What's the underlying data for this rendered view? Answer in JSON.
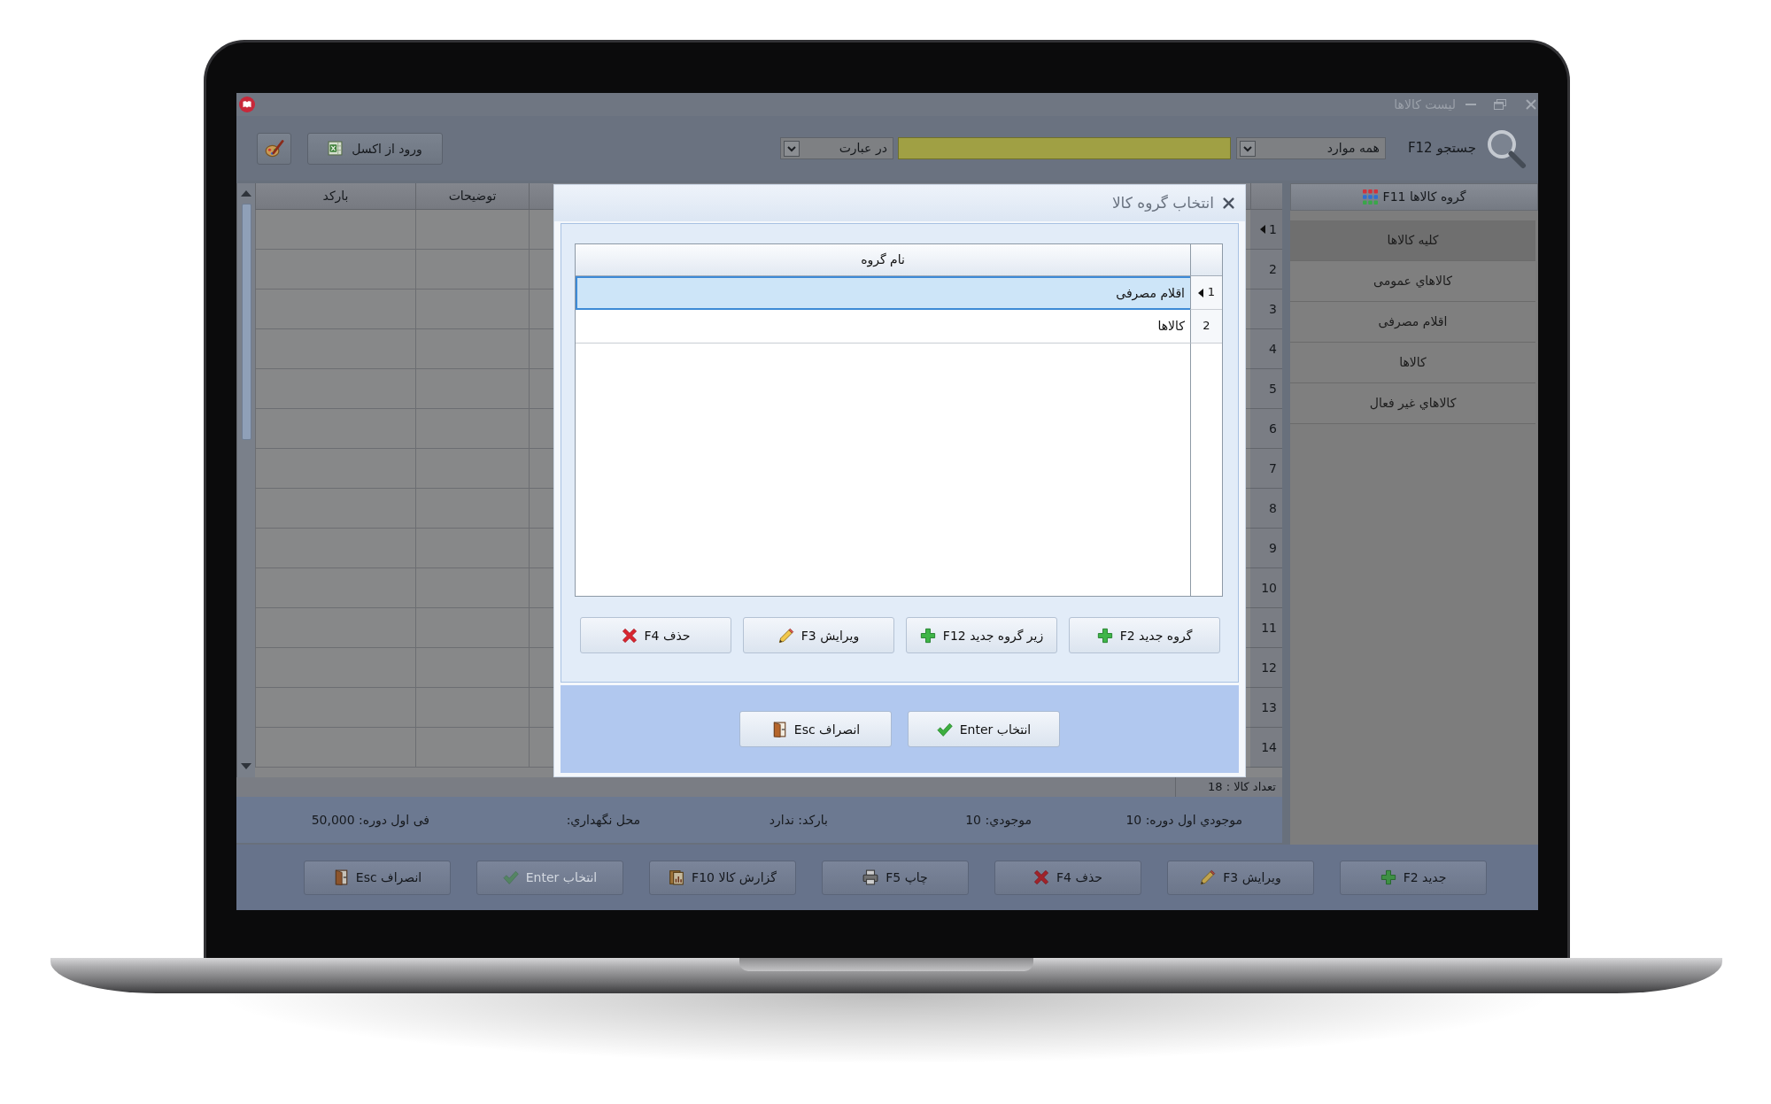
{
  "window": {
    "title": "لیست کالاها"
  },
  "toolbar": {
    "search_label": "جستجو F12",
    "scope": "همه موارد",
    "match_mode": "در عبارت",
    "import_button": "ورود از اکسل"
  },
  "sidebar": {
    "title": "گروه کالاها F11",
    "items": [
      {
        "label": "کلیه کالاها",
        "selected": true
      },
      {
        "label": "کالاهاي عمومی",
        "selected": false
      },
      {
        "label": "اقلام مصرفی",
        "selected": false
      },
      {
        "label": "کالاها",
        "selected": false
      },
      {
        "label": "کالاهاي غیر فعال",
        "selected": false
      }
    ]
  },
  "grid": {
    "columns": [
      "توضیحات",
      "بارکد"
    ],
    "rows": [
      {
        "number": "1",
        "selected": true
      },
      {
        "number": "2",
        "selected": false
      },
      {
        "number": "3",
        "selected": false
      },
      {
        "number": "4",
        "selected": false
      },
      {
        "number": "5",
        "selected": false
      },
      {
        "number": "6",
        "selected": false
      },
      {
        "number": "7",
        "selected": false
      },
      {
        "number": "8",
        "selected": false
      },
      {
        "number": "9",
        "selected": false
      },
      {
        "number": "10",
        "selected": false
      },
      {
        "number": "11",
        "selected": false
      },
      {
        "number": "12",
        "selected": false
      },
      {
        "number": "13",
        "selected": false
      },
      {
        "number": "14",
        "selected": false
      }
    ],
    "count": "تعداد کالا : 18"
  },
  "details": [
    "موجودي اول دوره: 10",
    "موجودي: 10",
    "بارکد: ندارد",
    "محل نگهداري:",
    "فی اول دوره: 50,000"
  ],
  "buttons": [
    {
      "label": "جدید F2",
      "kind": "add",
      "disabled": false
    },
    {
      "label": "ویرایش F3",
      "kind": "edit",
      "disabled": false
    },
    {
      "label": "حذف F4",
      "kind": "delete",
      "disabled": false
    },
    {
      "label": "چاپ F5",
      "kind": "print",
      "disabled": false
    },
    {
      "label": "گزارش کالا F10",
      "kind": "report",
      "disabled": false
    },
    {
      "label": "انتخاب Enter",
      "kind": "confirm",
      "disabled": true
    },
    {
      "label": "انصراف Esc",
      "kind": "cancel",
      "disabled": false
    }
  ],
  "dialog": {
    "title": "انتخاب گروه کالا",
    "columns": [
      "نام گروه"
    ],
    "rows": [
      {
        "number": "1",
        "name": "اقلام مصرفی",
        "selected": true
      },
      {
        "number": "2",
        "name": "کالاها",
        "selected": false
      }
    ],
    "actions": [
      {
        "label": "گروه جدید F2",
        "kind": "add"
      },
      {
        "label": "زیر گروه جدید F12",
        "kind": "add"
      },
      {
        "label": "ویرایش F3",
        "kind": "edit"
      },
      {
        "label": "حذف F4",
        "kind": "delete"
      }
    ],
    "footer_buttons": [
      {
        "label": "انتخاب Enter",
        "kind": "confirm"
      },
      {
        "label": "انصراف Esc",
        "kind": "cancel"
      }
    ]
  }
}
